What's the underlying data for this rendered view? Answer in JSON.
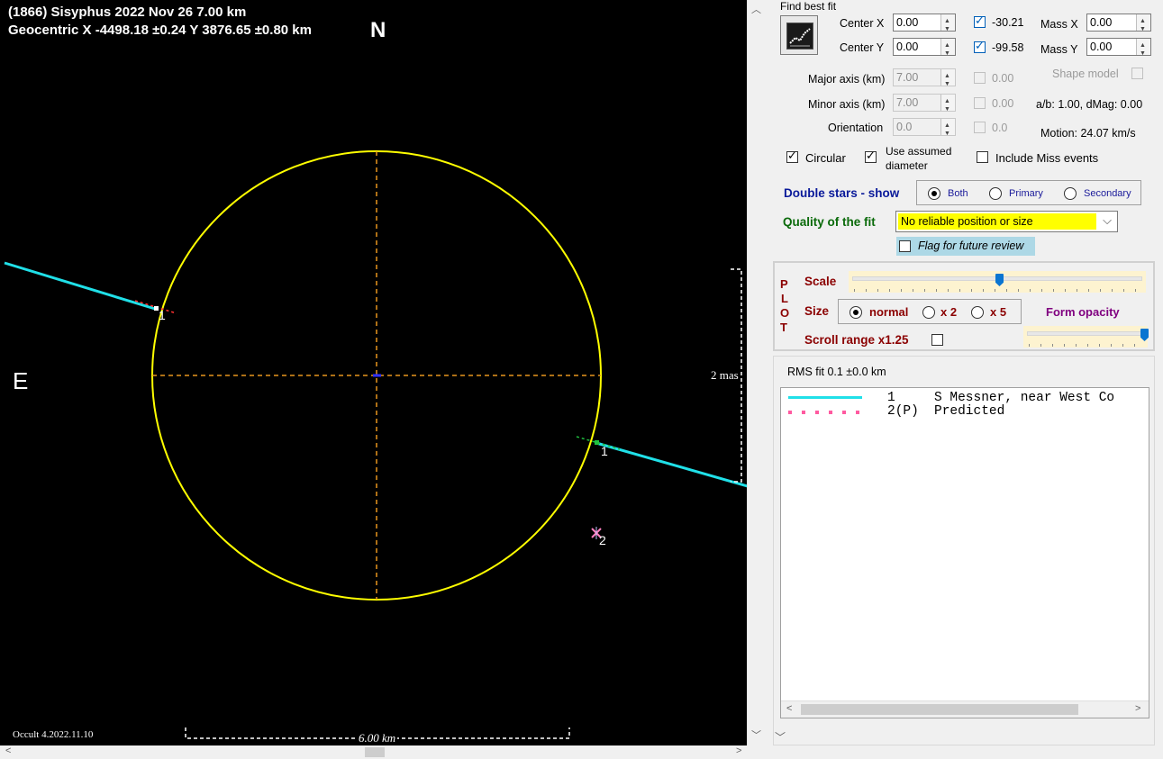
{
  "plot": {
    "title_line1": "(1866) Sisyphus  2022 Nov 26   7.00 km",
    "title_line2": "Geocentric  X  -4498.18 ±0.24  Y 3876.65 ±0.80 km",
    "north_label": "N",
    "east_label": "E",
    "scale_vertical_label": "2 mas",
    "scale_horizontal_label": "6.00 km",
    "version_label": "Occult 4.2022.11.10",
    "chord_label_a": "1",
    "chord_label_b": "1",
    "star_label": "2",
    "colors": {
      "ellipse": "#ffff00",
      "axes": "#e8961e",
      "chord": "#20e0e8",
      "background": "#000000"
    }
  },
  "fit": {
    "group_label": "Find best fit",
    "center_x_label": "Center X",
    "center_x_value": "0.00",
    "center_y_label": "Center Y",
    "center_y_value": "0.00",
    "cb_x_value": "-30.21",
    "cb_y_value": "-99.58",
    "mass_x_label": "Mass X",
    "mass_x_value": "0.00",
    "mass_y_label": "Mass Y",
    "mass_y_value": "0.00",
    "major_label": "Major axis (km)",
    "major_value": "7.00",
    "major_cb_value": "0.00",
    "shape_model_label": "Shape model",
    "minor_label": "Minor axis (km)",
    "minor_value": "7.00",
    "minor_cb_value": "0.00",
    "ab_text": "a/b: 1.00, dMag: 0.00",
    "orientation_label": "Orientation",
    "orientation_value": "0.0",
    "orientation_cb_value": "0.0",
    "motion_text": "Motion: 24.07 km/s",
    "circular_label": "Circular",
    "use_assumed_line1": "Use assumed",
    "use_assumed_line2": "diameter",
    "include_miss_label": "Include Miss events"
  },
  "double_stars": {
    "label": "Double stars - show",
    "options": [
      "Both",
      "Primary",
      "Secondary"
    ],
    "selected": "Both"
  },
  "quality": {
    "label": "Quality of the fit",
    "value": "No reliable position or size",
    "flag_label": "Flag for future review"
  },
  "plot_panel": {
    "side_letters": [
      "P",
      "L",
      "O",
      "T"
    ],
    "scale_label": "Scale",
    "scale_fraction": 0.5,
    "size_label": "Size",
    "size_options": [
      "normal",
      "x 2",
      "x 5"
    ],
    "size_selected": "normal",
    "form_opacity_label": "Form opacity",
    "opacity_fraction": 1.0,
    "scroll_range_label": "Scroll range x1.25"
  },
  "rms": {
    "text": "RMS fit 0.1 ±0.0 km"
  },
  "legend": {
    "rows": [
      {
        "id": "1",
        "text": "S Messner, near West Co",
        "style": "solid",
        "color": "#20e0e8"
      },
      {
        "id": "2(P)",
        "text": "Predicted",
        "style": "dotted",
        "color": "#ff5aa0"
      }
    ]
  }
}
